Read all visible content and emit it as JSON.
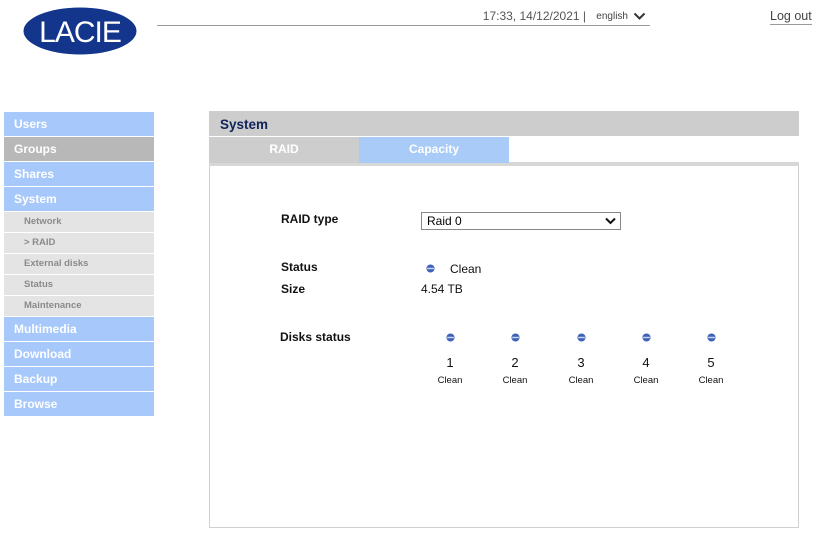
{
  "brand": {
    "logo_text": "LaCie",
    "logo_color": "#14358c"
  },
  "header": {
    "datetime": "17:33, 14/12/2021 |",
    "language": "english",
    "logout": "Log out"
  },
  "sidebar": {
    "items": [
      {
        "label": "Users"
      },
      {
        "label": "Groups"
      },
      {
        "label": "Shares"
      },
      {
        "label": "System"
      },
      {
        "label": "Network"
      },
      {
        "label": "> RAID"
      },
      {
        "label": "External disks"
      },
      {
        "label": "Status"
      },
      {
        "label": "Maintenance"
      },
      {
        "label": "Multimedia"
      },
      {
        "label": "Download"
      },
      {
        "label": "Backup"
      },
      {
        "label": "Browse"
      }
    ]
  },
  "panel": {
    "title": "System",
    "tabs": [
      {
        "label": "RAID"
      },
      {
        "label": "Capacity"
      }
    ],
    "raid_type_label": "RAID type",
    "raid_type_value": "Raid 0",
    "status_label": "Status",
    "status_value": "Clean",
    "size_label": "Size",
    "size_value": "4.54 TB",
    "disks_label": "Disks status",
    "disks": [
      {
        "number": "1",
        "status": "Clean"
      },
      {
        "number": "2",
        "status": "Clean"
      },
      {
        "number": "3",
        "status": "Clean"
      },
      {
        "number": "4",
        "status": "Clean"
      },
      {
        "number": "5",
        "status": "Clean"
      }
    ]
  },
  "colors": {
    "nav_blue": "#a7c8fa",
    "nav_grey": "#b8b8b8",
    "title_text": "#0f2358",
    "status_led": "#3f62b8"
  },
  "icons": {
    "status_led": "blue-status-led-icon",
    "dropdown": "chevron-down-icon"
  }
}
